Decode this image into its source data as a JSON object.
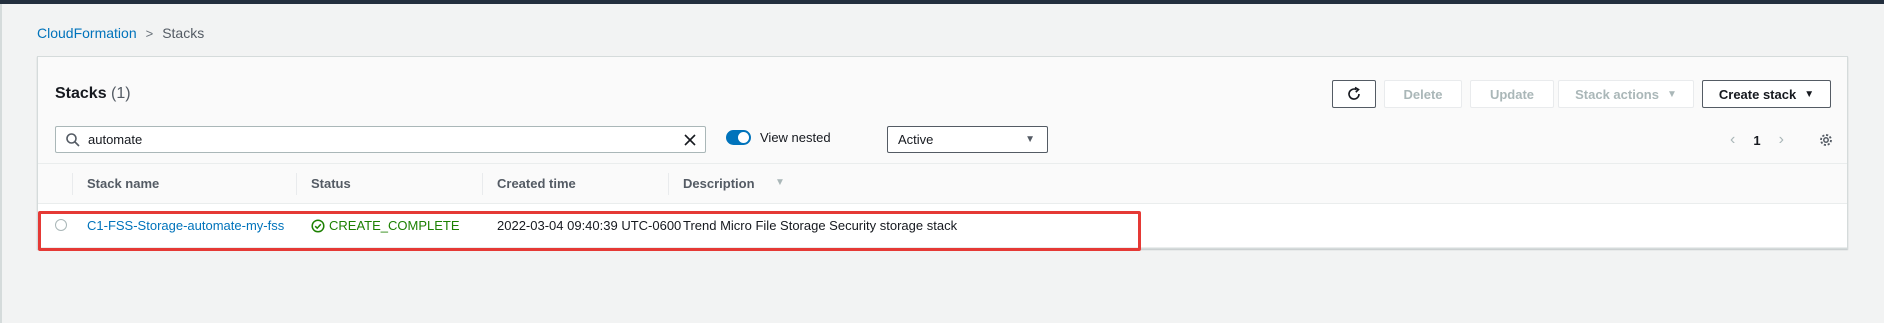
{
  "breadcrumb": {
    "root": "CloudFormation",
    "separator": ">",
    "current": "Stacks"
  },
  "panel": {
    "title": "Stacks",
    "count": "(1)"
  },
  "toolbar": {
    "delete_label": "Delete",
    "update_label": "Update",
    "stack_actions_label": "Stack actions",
    "create_stack_label": "Create stack"
  },
  "filter": {
    "search_value": "automate",
    "view_nested_label": "View nested",
    "view_nested_on": true,
    "status_select": "Active"
  },
  "pagination": {
    "page": "1"
  },
  "table": {
    "columns": [
      "Stack name",
      "Status",
      "Created time",
      "Description"
    ],
    "rows": [
      {
        "stack_name": "C1-FSS-Storage-automate-my-fss",
        "status": "CREATE_COMPLETE",
        "created_time": "2022-03-04 09:40:39 UTC-0600",
        "description": "Trend Micro File Storage Security storage stack"
      }
    ]
  },
  "colors": {
    "link": "#0073bb",
    "success": "#1d8102",
    "highlight": "#e53935"
  }
}
